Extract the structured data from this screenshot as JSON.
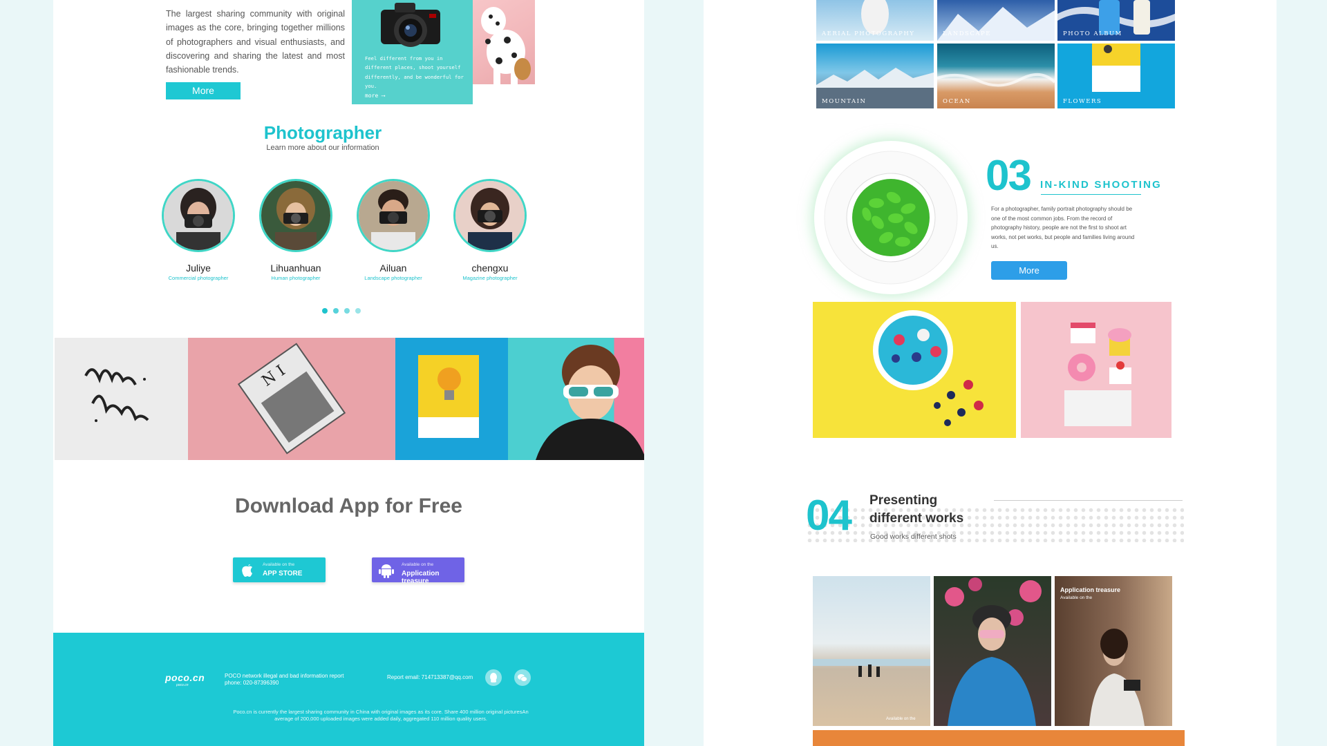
{
  "about": {
    "text": "The largest sharing community with original images as the core, bringing together millions of photographers and visual enthusiasts, and discovering and sharing the latest and most fashionable trends.",
    "more_label": "More",
    "card_text": "Feel different from you in different places, shoot yourself differently, and be wonderful for you.",
    "card_more": "more"
  },
  "photographers": {
    "title": "Photographer",
    "subtitle": "Learn more about our information",
    "people": [
      {
        "name": "Juliye",
        "role": "Commercial photographer"
      },
      {
        "name": "Lihuanhuan",
        "role": "Human photographer"
      },
      {
        "name": "Ailuan",
        "role": "Landscape photographer"
      },
      {
        "name": "chengxu",
        "role": "Magazine photographer"
      }
    ]
  },
  "download": {
    "title": "Download App for Free",
    "appstore_small": "Available on the",
    "appstore_big": "APP  STORE",
    "android_small": "Available on the",
    "android_big": "Application treasure"
  },
  "footer": {
    "logo": "poco.cn",
    "logo_sub": "poco.cn",
    "notice": "POCO network illegal and bad information report phone: 020-87396390",
    "email": "Report email: 714713387@qq.com",
    "description": "Poco.cn is currently the largest sharing community in China with original images as its core. Share 400 million original picturesAn average of 200,000 uploaded images were added daily, aggregated 110 million quality users."
  },
  "categories": [
    {
      "label": "AERIAL PHOTOGRAPHY"
    },
    {
      "label": "LANDSCAPE"
    },
    {
      "label": "PHOTO ALBUM"
    },
    {
      "label": "MOUNTAIN"
    },
    {
      "label": "OCEAN"
    },
    {
      "label": "FLOWERS"
    }
  ],
  "section03": {
    "number": "03",
    "title": "IN-KIND SHOOTING",
    "text": "For a photographer, family portrait photography should be one of the most common jobs. From the record of photography history, people are not the first to shoot art works, not pet works, but people and families living around us.",
    "more_label": "More"
  },
  "section04": {
    "number": "04",
    "title": "Presenting different works",
    "subtitle": "Good works different shots",
    "overlay_title": "Application treasure",
    "overlay_sub": "Available on the",
    "photo1_caption": "Available on the"
  },
  "colors": {
    "accent": "#1ec3cd",
    "footer": "#1dc9d4",
    "blue_button": "#2d9ee8",
    "android_button": "#6f63e6"
  }
}
